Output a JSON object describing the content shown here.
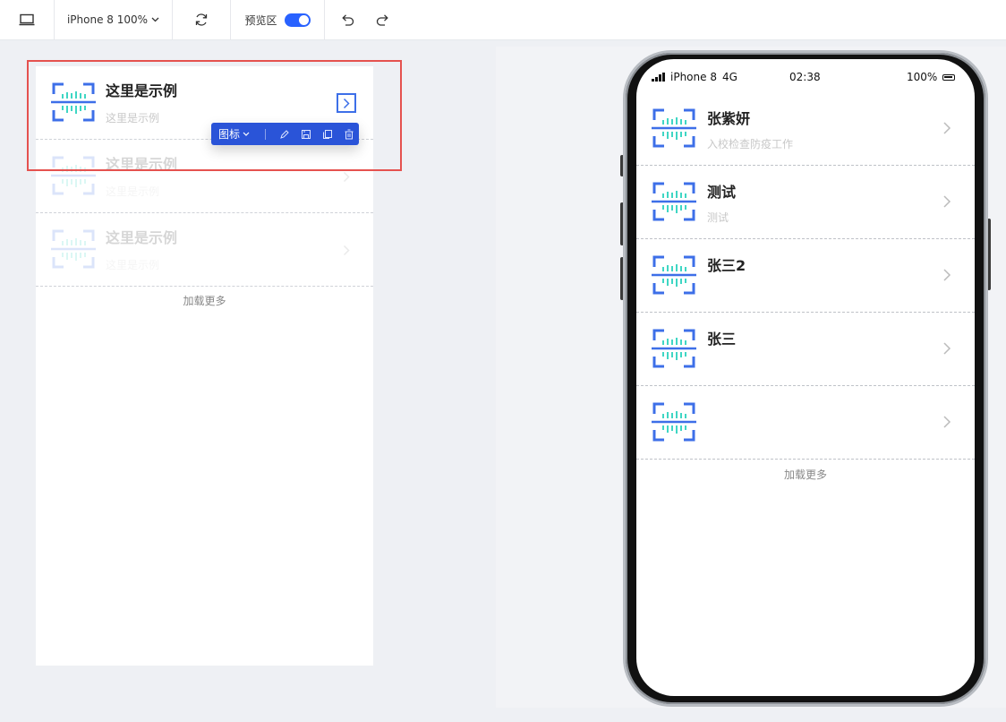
{
  "toolbar": {
    "device_label": "iPhone 8 100%",
    "preview_label": "预览区",
    "preview_enabled": true
  },
  "editor": {
    "items": [
      {
        "title": "这里是示例",
        "subtitle": "这里是示例"
      },
      {
        "title": "这里是示例",
        "subtitle": "这里是示例"
      },
      {
        "title": "这里是示例",
        "subtitle": "这里是示例"
      }
    ],
    "load_more": "加载更多",
    "component_toolbar": {
      "type_label": "图标",
      "actions": [
        "edit-icon",
        "save-icon",
        "copy-icon",
        "delete-icon"
      ]
    }
  },
  "preview": {
    "status_bar": {
      "carrier": "iPhone 8",
      "network": "4G",
      "time": "02:38",
      "battery": "100%"
    },
    "items": [
      {
        "title": "张紫妍",
        "subtitle": "入校检查防疫工作"
      },
      {
        "title": "测试",
        "subtitle": "测试"
      },
      {
        "title": "张三2",
        "subtitle": ""
      },
      {
        "title": "张三",
        "subtitle": ""
      },
      {
        "title": "",
        "subtitle": ""
      }
    ],
    "load_more": "加载更多"
  },
  "colors": {
    "accent": "#2962ff",
    "icon_blue": "#3d6fe8",
    "icon_teal": "#3fd6c4",
    "selection_red": "#e5524f",
    "component_toolbar": "#2a54d8"
  }
}
